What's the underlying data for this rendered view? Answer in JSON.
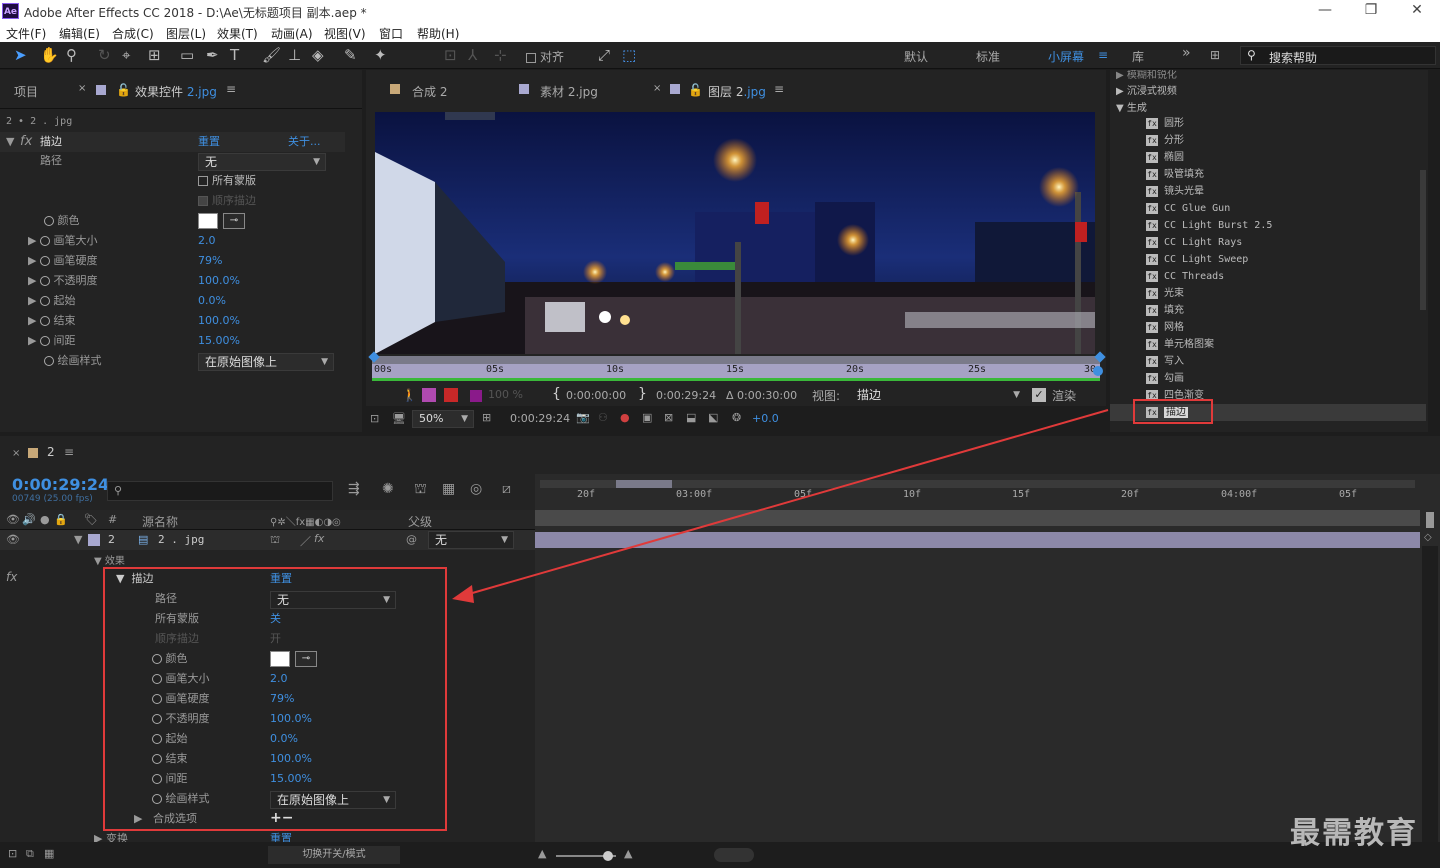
{
  "window": {
    "title": "Adobe After Effects CC 2018 - D:\\Ae\\无标题项目 副本.aep *",
    "app_badge": "Ae"
  },
  "menu": [
    "文件(F)",
    "编辑(E)",
    "合成(C)",
    "图层(L)",
    "效果(T)",
    "动画(A)",
    "视图(V)",
    "窗口",
    "帮助(H)"
  ],
  "toolbar": {
    "snap_label": "对齐",
    "workspaces": [
      "默认",
      "标准",
      "小屏幕",
      "库"
    ],
    "active_workspace": "小屏幕",
    "search_placeholder": "搜索帮助"
  },
  "left_panel": {
    "tab_project": "项目",
    "tab_effects": "效果控件",
    "tab_effects_layer": "2.jpg",
    "breadcrumb": "2 • 2 . jpg",
    "fx": "fx",
    "effect_name": "描边",
    "reset": "重置",
    "about": "关于...",
    "path_label": "路径",
    "path_value": "无",
    "all_masks": "所有蒙版",
    "seq_stroke": "顺序描边",
    "color_label": "颜色",
    "props": [
      {
        "label": "画笔大小",
        "value": "2.0"
      },
      {
        "label": "画笔硬度",
        "value": "79%"
      },
      {
        "label": "不透明度",
        "value": "100.0%"
      },
      {
        "label": "起始",
        "value": "0.0%"
      },
      {
        "label": "结束",
        "value": "100.0%"
      },
      {
        "label": "间距",
        "value": "15.00%"
      }
    ],
    "paint_style_label": "绘画样式",
    "paint_style_value": "在原始图像上"
  },
  "viewer": {
    "tabs": [
      {
        "label": "合成 2",
        "blue": ""
      },
      {
        "label": "素材 2",
        "blue": ".jpg"
      },
      {
        "label": "图层 2",
        "blue": ".jpg"
      }
    ],
    "ruler_labels": [
      "00s",
      "05s",
      "10s",
      "15s",
      "20s",
      "25s",
      "30s"
    ],
    "opacity": "100 %",
    "in_time": "0:00:00:00",
    "out_time": "0:00:29:24",
    "duration": "Δ 0:00:30:00",
    "view_label": "视图:",
    "view_value": "描边",
    "render_label": "渲染",
    "zoom": "50%",
    "current_time": "0:00:29:24",
    "exposure": "+0.0"
  },
  "effects_list": {
    "partial_top": "模糊和锐化",
    "categories": [
      "沉浸式视频",
      "生成"
    ],
    "items": [
      "圆形",
      "分形",
      "椭圆",
      "吸管填充",
      "镜头光晕",
      "CC Glue Gun",
      "CC Light Burst 2.5",
      "CC Light Rays",
      "CC Light Sweep",
      "CC Threads",
      "光束",
      "填充",
      "网格",
      "单元格图案",
      "写入",
      "勾画",
      "四色渐变",
      "描边"
    ],
    "selected": "描边"
  },
  "timeline": {
    "comp_tab": "2",
    "timecode": "0:00:29:24",
    "frame_info": "00749 (25.00 fps)",
    "col_source": "源名称",
    "col_parent": "父级",
    "layer_num": "2",
    "layer_name": "2 . jpg",
    "parent_value": "无",
    "effects_group": "效果",
    "fx": "fx",
    "effect_name": "描边",
    "reset": "重置",
    "path_label": "路径",
    "path_value": "无",
    "all_masks": "所有蒙版",
    "all_masks_value": "关",
    "seq_stroke": "顺序描边",
    "seq_stroke_value": "开",
    "color_label": "颜色",
    "props": [
      {
        "label": "画笔大小",
        "value": "2.0"
      },
      {
        "label": "画笔硬度",
        "value": "79%"
      },
      {
        "label": "不透明度",
        "value": "100.0%"
      },
      {
        "label": "起始",
        "value": "0.0%"
      },
      {
        "label": "结束",
        "value": "100.0%"
      },
      {
        "label": "间距",
        "value": "15.00%"
      }
    ],
    "paint_style_label": "绘画样式",
    "paint_style_value": "在原始图像上",
    "composite_label": "合成选项",
    "composite_ctrl": "+−",
    "transform_partial": "变换",
    "ruler": [
      "20f",
      "03:00f",
      "05f",
      "10f",
      "15f",
      "20f",
      "04:00f",
      "05f"
    ],
    "toggle_label": "切换开关/模式"
  },
  "watermark": "最需教育",
  "colors": {
    "accent_blue": "#3f8fe0",
    "highlight_red": "#e03a3a",
    "timeline_bar": "#8c88a8"
  }
}
